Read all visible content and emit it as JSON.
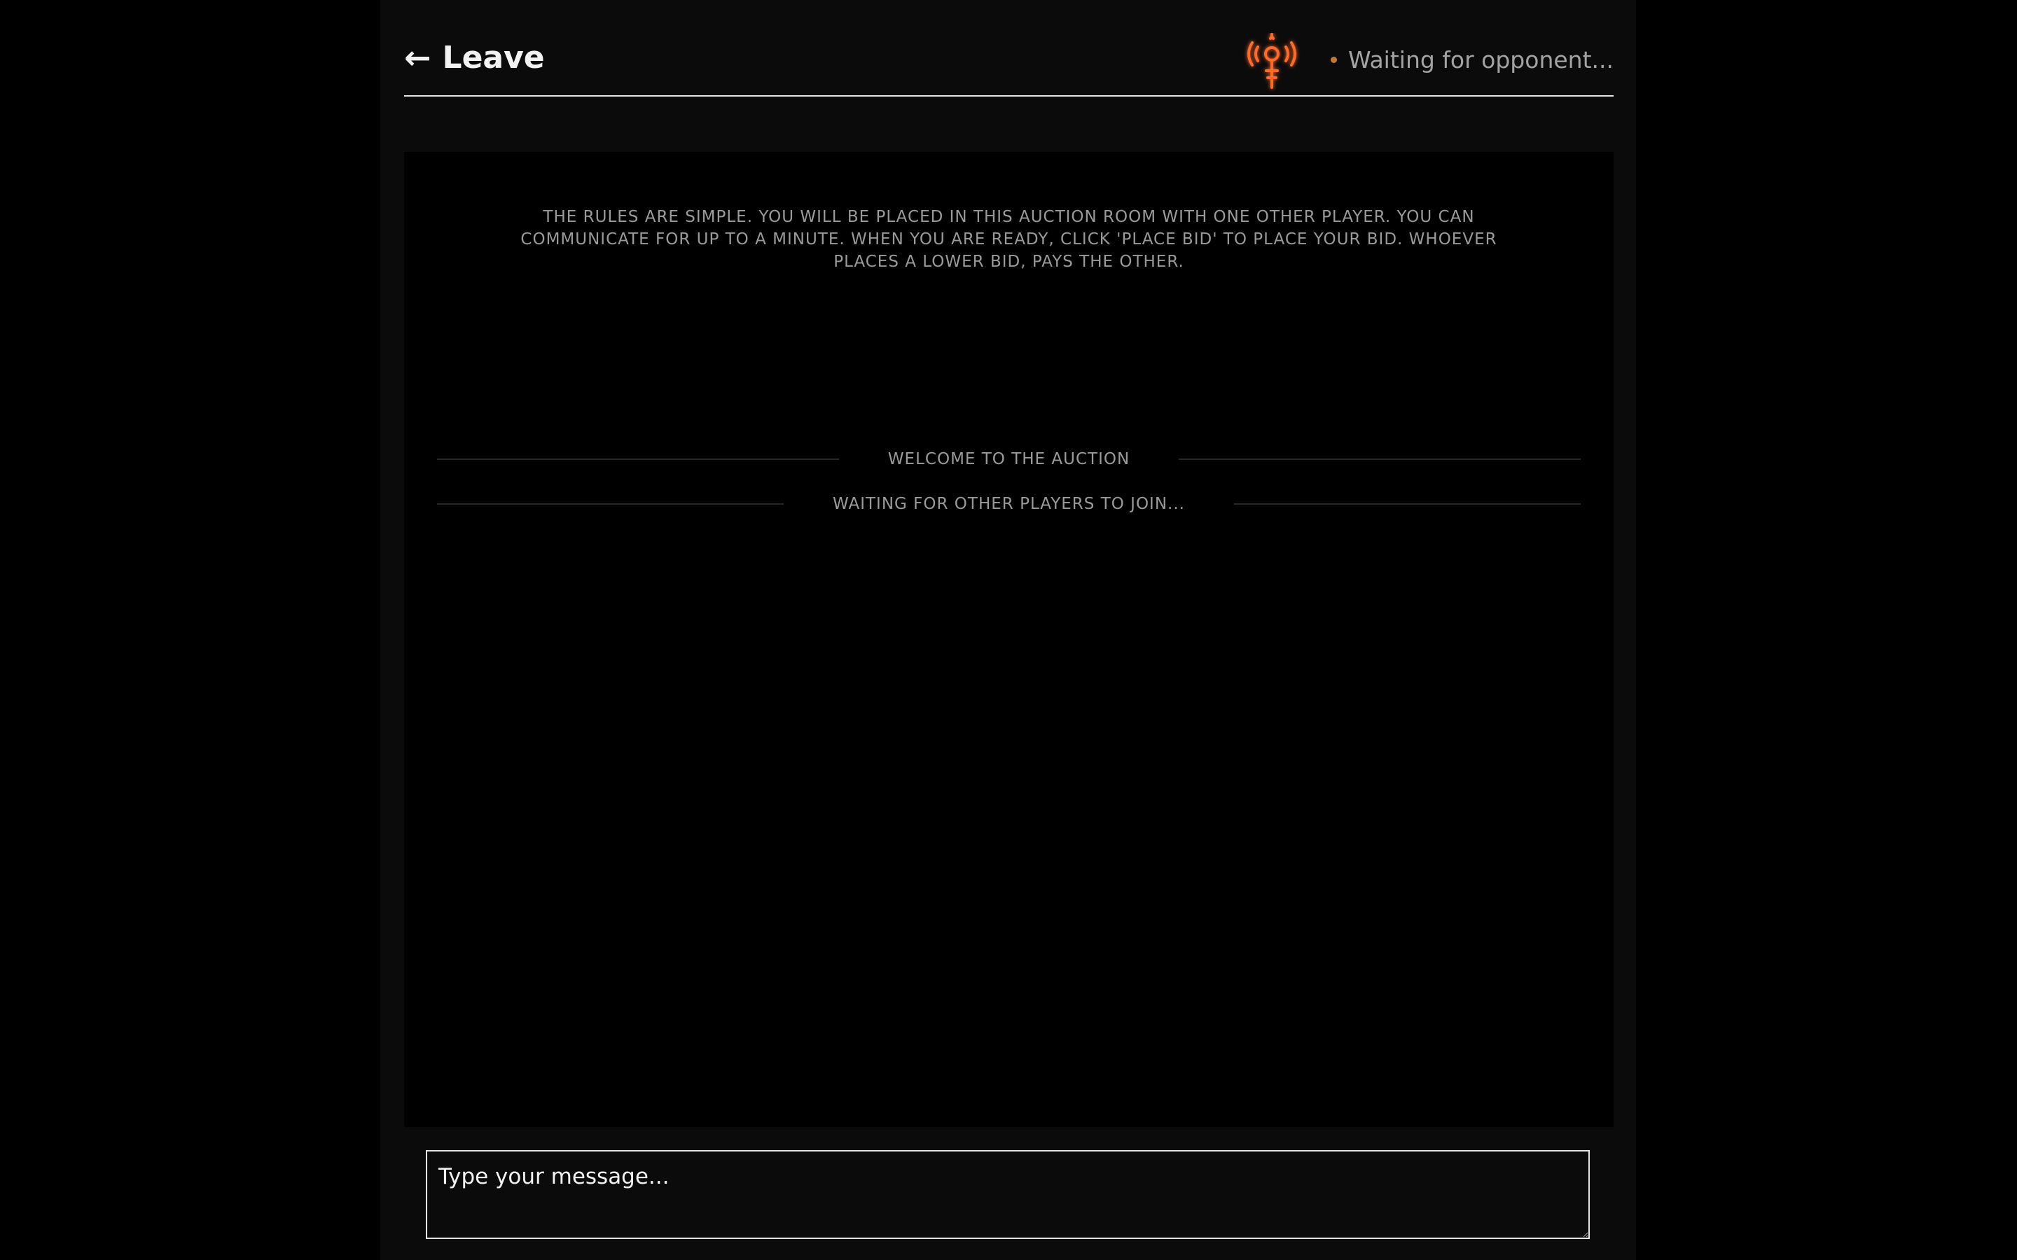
{
  "header": {
    "leave_label": "Leave",
    "status_text": "Waiting for opponent..."
  },
  "chat": {
    "rules_text": "The rules are simple. You will be placed in this auction room with one other player. You can communicate for up to a minute. When you are ready, click 'Place Bid' to place your bid. Whoever places a lower bid, pays the other.",
    "system_messages": [
      "Welcome to the auction",
      "Waiting for other players to join..."
    ]
  },
  "composer": {
    "placeholder": "Type your message..."
  },
  "icons": {
    "back": "left-arrow-icon",
    "logo": "robot-logo-icon",
    "status": "status-dot-icon"
  },
  "colors": {
    "accent": "#ff6a2b",
    "status_dot": "#c17a2a",
    "background": "#000000",
    "panel": "#0b0b0b",
    "text_primary": "#f2f2f2",
    "text_muted": "#9a9a9a"
  }
}
